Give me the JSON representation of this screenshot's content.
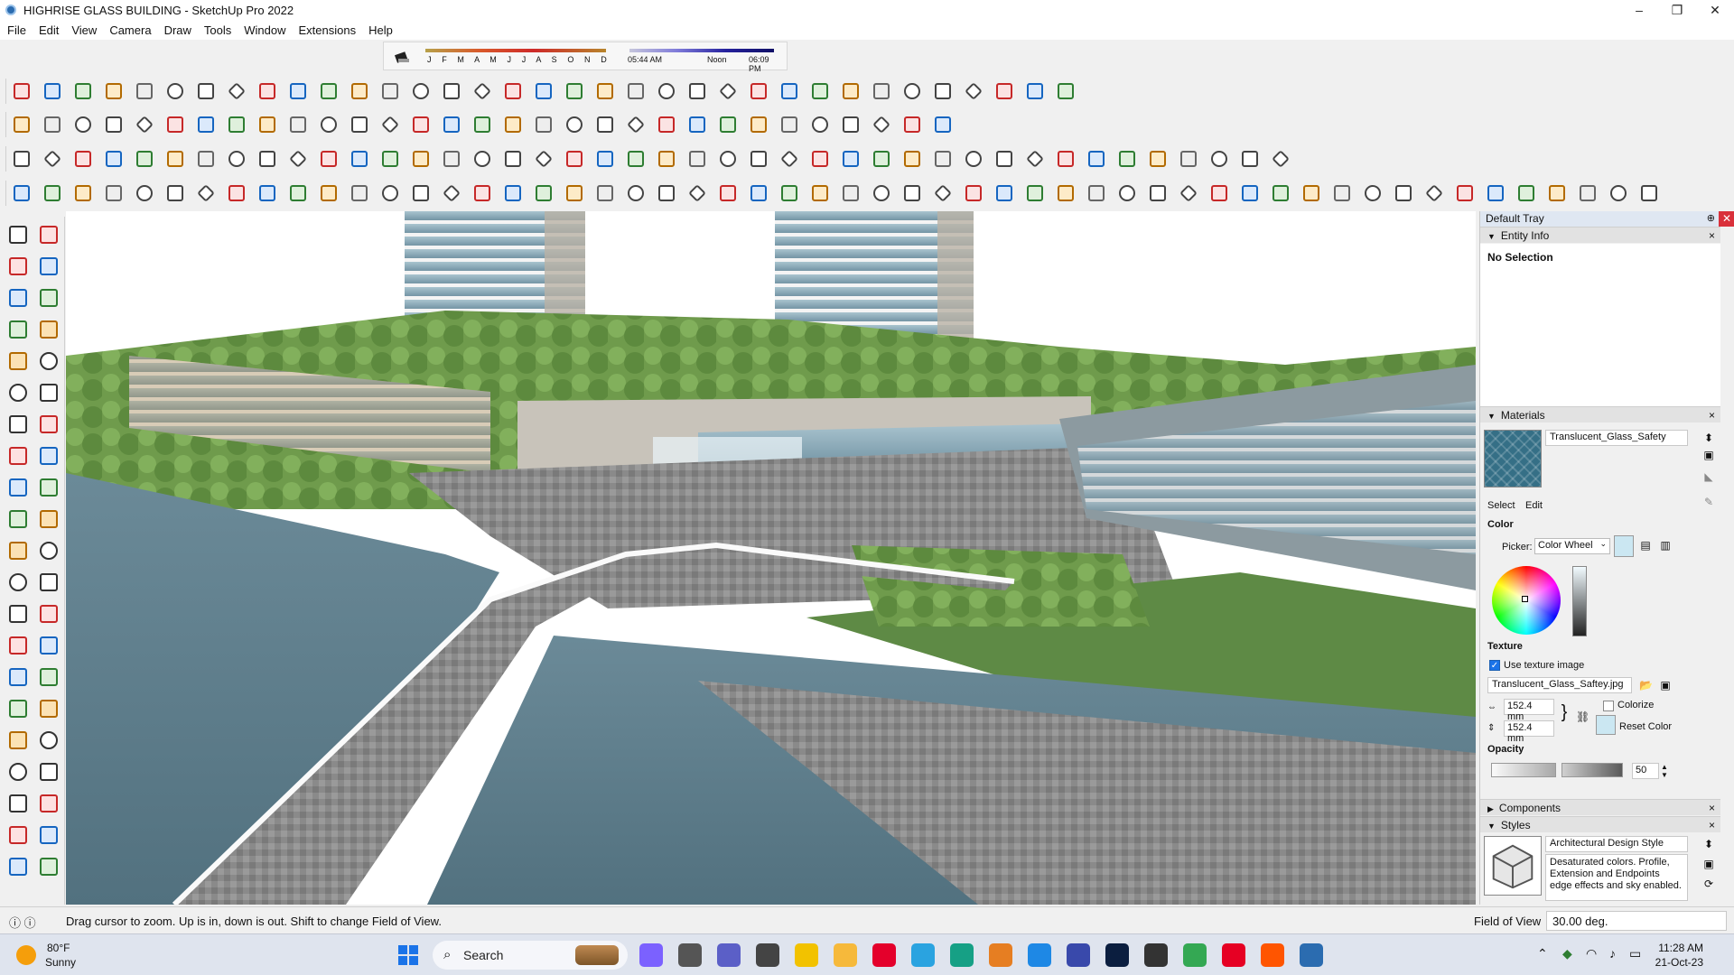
{
  "window": {
    "title": "HIGHRISE GLASS BUILDING - SketchUp Pro 2022",
    "controls": {
      "minimize": "–",
      "restore": "❐",
      "close": "✕"
    }
  },
  "menu": [
    "File",
    "Edit",
    "View",
    "Camera",
    "Draw",
    "Tools",
    "Window",
    "Extensions",
    "Help"
  ],
  "shadow_bar": {
    "months": "J F M A M J J A S O N D",
    "time_start": "05:44 AM",
    "time_mid": "Noon",
    "time_end": "06:09 PM"
  },
  "toolbar_icons": {
    "row1": [
      "circle-3pt-icon",
      "bezier-icon",
      "spline-icon",
      "select-pick-icon",
      "eraser-tool-icon",
      "joint-push-pull-icon",
      "extrude-icon",
      "curviloft-icon",
      "round-corner-icon",
      "fillet-icon",
      "chamfer-icon",
      "line-icon",
      "arc-icon",
      "roof-icon",
      "stair-icon",
      "wall-icon",
      "window-icon",
      "door-icon",
      "rail-icon",
      "grid-icon",
      "joist-icon",
      "rafter-icon",
      "frame-icon",
      "truss-icon",
      "slab-icon",
      "column-icon",
      "beam-icon",
      "mullion-icon",
      "louver-icon",
      "sweep-icon",
      "fence-icon",
      "house-icon",
      "building-icon",
      "home-icon",
      "shed-icon"
    ],
    "row2": [
      "zoom-magnifier-icon",
      "select-arrow-icon",
      "eraser-icon",
      "pencil-icon",
      "freehand-icon",
      "rectangle-icon",
      "push-pull-icon",
      "follow-me-icon",
      "move-icon",
      "rotate-icon",
      "scale-icon",
      "tape-measure-icon",
      "text-icon",
      "paint-bucket-icon",
      "orbit-icon",
      "pan-icon",
      "zoom-icon",
      "zoom-extents-icon",
      "section-plane-icon",
      "layers-icon",
      "scenes-icon",
      "styles-icon",
      "shadows-icon",
      "sandbox-icon",
      "arrow-red-icon",
      "arrow-blue-icon",
      "arrow-red-2-icon",
      "arrow-green-icon",
      "arrow-orange-icon",
      "arrow-magenta-icon",
      "fredo-icon"
    ],
    "row3": [
      "camera-icon",
      "box-icon",
      "box-2-icon",
      "hidden-line-icon",
      "x-ray-icon",
      "grid-toggle-icon",
      "component-icon",
      "edit-icon",
      "group-icon",
      "tag-icon",
      "pencil-2-icon",
      "circle-icon",
      "polygon-icon",
      "ellipse-icon",
      "parallelogram-icon",
      "offset-icon",
      "intersect-icon",
      "shape-icon",
      "line-2-icon",
      "measure-icon",
      "flip-icon",
      "mirror-icon",
      "array-icon",
      "align-icon",
      "terrain-icon",
      "tree-icon",
      "material-icon",
      "axes-icon",
      "guide-icon",
      "rotate-2-icon",
      "copy-icon",
      "view-front-icon",
      "view-top-icon",
      "view-iso-icon",
      "view-back-icon",
      "view-left-icon",
      "section-icon",
      "layer-2-icon",
      "paint-2-icon",
      "hat-icon",
      "shed-2-icon",
      "stone-icon"
    ],
    "row4": [
      "scene-icon",
      "lamp-icon",
      "sphere-icon",
      "cone-icon",
      "table-icon",
      "torus-icon",
      "dome-icon",
      "cube-icon",
      "sphere-2-icon",
      "cube-3d-icon",
      "cube-3d-2-icon",
      "cube-3d-3-icon",
      "globe-icon",
      "globe-2-icon",
      "cursor-box-icon",
      "gem-blue-icon",
      "gem-blue-2-icon",
      "gem-yellow-icon",
      "gem-green-icon",
      "gem-red-icon",
      "gem-gray-icon",
      "undo-orange-icon",
      "square-red-icon",
      "stack-red-icon",
      "page-icon",
      "chair-icon",
      "link-icon",
      "spline-2-icon",
      "path-red-icon",
      "plus-red-icon",
      "plus-green-icon",
      "x-blue-icon",
      "cone-2-icon",
      "cone-3-icon",
      "cone-4-icon",
      "ring-icon",
      "ring-2-icon",
      "ring-3-icon",
      "target-icon",
      "bucket-icon",
      "magnet-icon",
      "fork-icon",
      "hammer-icon",
      "brick-icon",
      "brick-2-icon",
      "gear-icon",
      "hex-icon",
      "lattice-icon",
      "lattice-2-icon",
      "lattice-3-icon",
      "lattice-4-icon",
      "x-red-icon",
      "curve-icon",
      "table-2-icon"
    ]
  },
  "left_tools": [
    "select-icon",
    "orbit-icon",
    "paint-bucket-icon",
    "eraser-icon",
    "component-icon",
    "tape-icon",
    "pencil-icon",
    "freehand-icon",
    "rectangle-icon",
    "rect-2-icon",
    "circle-icon",
    "polygon-icon",
    "arc-icon",
    "arc-2-icon",
    "arc-3-icon",
    "pie-icon",
    "move-icon",
    "push-pull-icon",
    "rotate-icon",
    "follow-me-icon",
    "scale-icon",
    "offset-icon",
    "tape-measure-icon",
    "dimension-icon",
    "protractor-icon",
    "text-icon",
    "axes-icon",
    "3d-text-icon",
    "orbit-2-icon",
    "pan-icon",
    "zoom-icon",
    "zoom-window-icon",
    "zoom-extents-icon",
    "previous-view-icon",
    "walk-icon",
    "look-around-icon",
    "footprints-icon",
    "position-camera-icon",
    "section-plane-icon",
    "section-fill-icon",
    "section-stack-icon",
    "section-display-icon"
  ],
  "tray": {
    "title": "Default Tray",
    "entity_info": {
      "header": "Entity Info",
      "selection": "No Selection"
    },
    "materials": {
      "header": "Materials",
      "name": "Translucent_Glass_Safety",
      "tab_select": "Select",
      "tab_edit": "Edit",
      "color_label": "Color",
      "picker_label": "Picker:",
      "picker_value": "Color Wheel",
      "texture_label": "Texture",
      "use_texture": "Use texture image",
      "texture_file": "Translucent_Glass_Saftey.jpg",
      "width": "152.4 mm",
      "height": "152.4 mm",
      "colorize": "Colorize",
      "reset_color": "Reset Color",
      "opacity_label": "Opacity",
      "opacity_value": "50",
      "opacity_fraction": 0.5,
      "swatch_color": "#356f86",
      "color_value": "#cbe7f2"
    },
    "components": {
      "header": "Components"
    },
    "styles": {
      "header": "Styles",
      "name": "Architectural Design Style",
      "description": "Desaturated colors. Profile, Extension and Endpoints edge effects and sky enabled."
    }
  },
  "status": {
    "message": "Drag cursor to zoom.  Up is in, down is out. Shift to change Field of View.",
    "fov_label": "Field of View",
    "fov_value": "30.00 deg."
  },
  "taskbar": {
    "weather_temp": "80°F",
    "weather_cond": "Sunny",
    "search_placeholder": "Search",
    "apps": [
      "copilot-icon",
      "task-view-icon",
      "teams-icon",
      "calculator-icon",
      "sticky-notes-icon",
      "file-explorer-icon",
      "opera-icon",
      "telegram-icon",
      "app-green-icon",
      "gradle-icon",
      "tools-icon",
      "app-blue-icon",
      "photoshop-icon",
      "vpn-icon",
      "chrome-icon",
      "pinterest-icon",
      "soundcloud-icon",
      "sketchup-icon"
    ],
    "time": "11:28 AM",
    "date": "21-Oct-23"
  }
}
